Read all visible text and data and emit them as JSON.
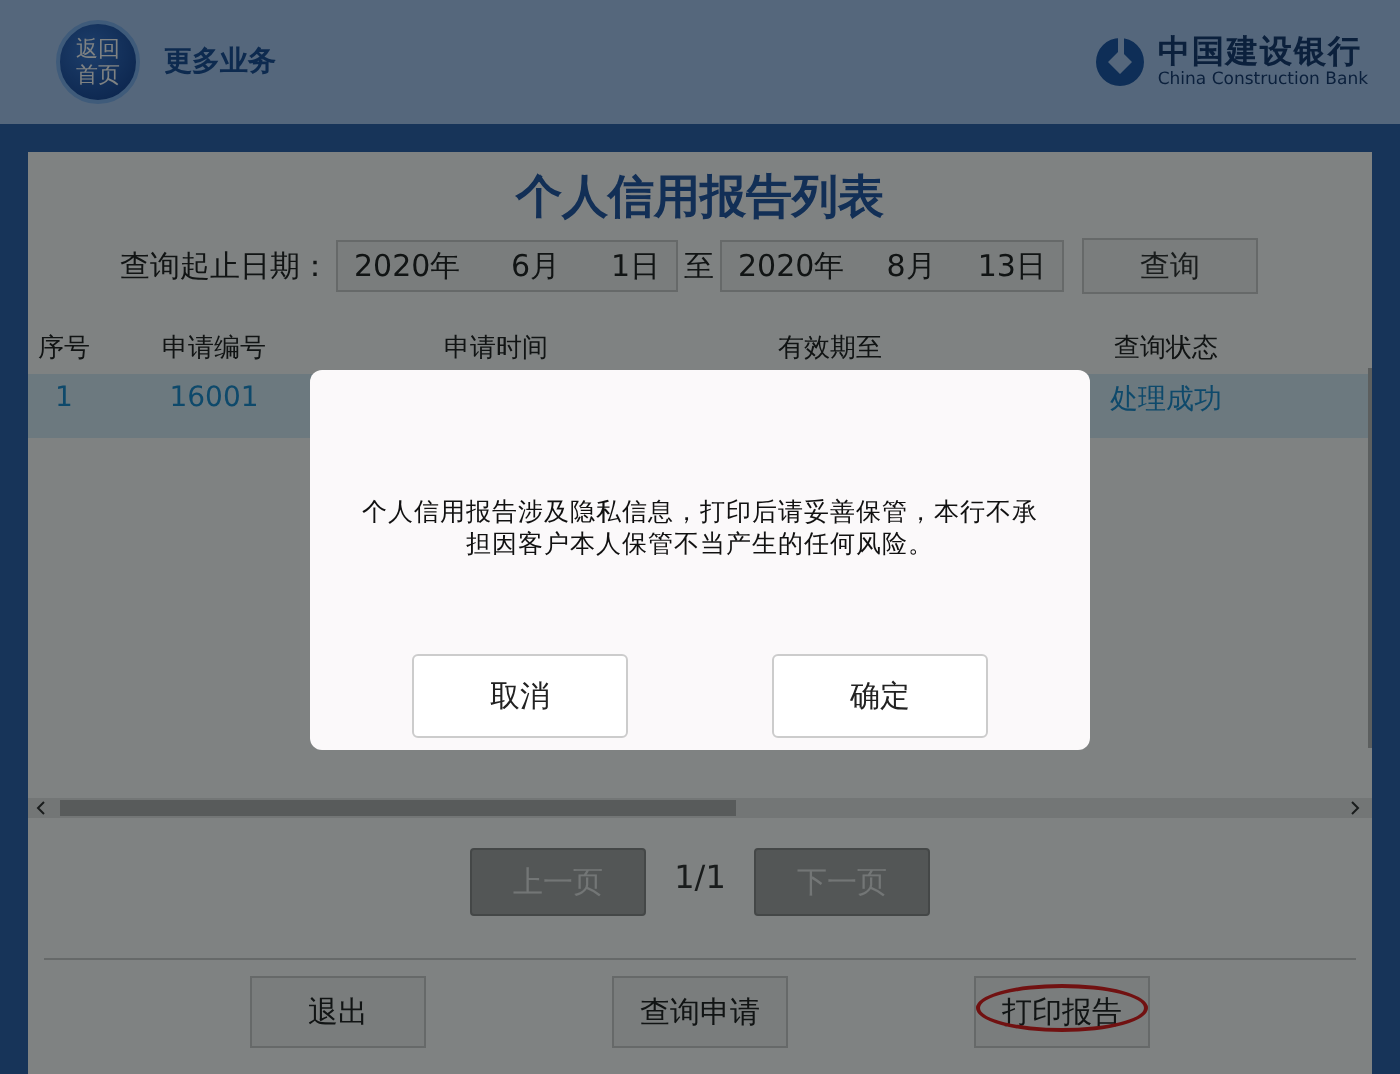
{
  "header": {
    "home_button": "返回首页",
    "title": "更多业务",
    "logo_name": "中国建设银行",
    "logo_subtitle": "China Construction Bank"
  },
  "panel": {
    "title": "个人信用报告列表",
    "query": {
      "label": "查询起止日期：",
      "from": {
        "year": "2020年",
        "month": "6月",
        "day": "1日"
      },
      "separator": "至",
      "to": {
        "year": "2020年",
        "month": "8月",
        "day": "13日"
      },
      "button": "查询"
    },
    "table": {
      "columns": [
        "序号",
        "申请编号",
        "申请时间",
        "有效期至",
        "查询状态"
      ],
      "rows": [
        {
          "selected": true,
          "no": "1",
          "application_no": "16001",
          "status": "处理成功"
        }
      ]
    },
    "pagination": {
      "prev": {
        "label": "上一页",
        "disabled": true
      },
      "page": "1/1",
      "next": {
        "label": "下一页",
        "disabled": true
      }
    },
    "actions": [
      {
        "label": "退出",
        "circled": false
      },
      {
        "label": "查询申请",
        "circled": false
      },
      {
        "label": "打印报告",
        "circled": true
      }
    ]
  },
  "dialog": {
    "message": "个人信用报告涉及隐私信息，打印后请妥善保管，本行不承担因客户本人保管不当产生的任何风险。",
    "buttons": [
      "取消",
      "确定"
    ]
  }
}
